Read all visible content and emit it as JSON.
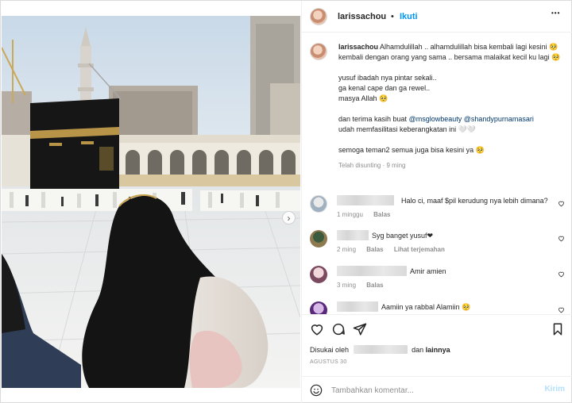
{
  "post": {
    "author": "larissachou",
    "separator": "•",
    "follow_label": "Ikuti",
    "more_label": "•••",
    "carousel": {
      "slide_count": 2,
      "active_slide": 1
    }
  },
  "caption": {
    "username": "larissachou",
    "line1": "Alhamdulillah .. alhamdulillah bisa kembali lagi kesini 🥺",
    "line2": "kembali dengan orang yang sama .. bersama malaikat kecil ku lagi 🥺",
    "line3": "yusuf ibadah nya pintar sekali..",
    "line4": "ga kenal cape dan ga rewel..",
    "line5": "masya Allah 🥺",
    "line6_prefix": "dan terima kasih buat ",
    "mention1": "@msglowbeauty",
    "mention2": "@shandypurnamasari",
    "line7": "udah memfasilitasi keberangkatan ini 🤍🤍",
    "line8": "semoga teman2 semua juga bisa kesini ya 🥺",
    "meta": "Telah disunting · 9 ming"
  },
  "comments": [
    {
      "text": "Halo ci, maaf $pil kerudung nya lebih dimana?",
      "time": "1 minggu",
      "reply": "Balas",
      "translate": ""
    },
    {
      "text": "Syg banget yusuf❤",
      "time": "2 ming",
      "reply": "Balas",
      "translate": "Lihat terjemahan"
    },
    {
      "text": "Amir amien",
      "time": "3 ming",
      "reply": "Balas",
      "translate": ""
    },
    {
      "text": "Aamiin ya rabbal Alamiin 🥺",
      "time": "",
      "reply": "",
      "translate": ""
    }
  ],
  "likes": {
    "prefix": "Disukai oleh",
    "middle": "dan",
    "suffix": "lainnya"
  },
  "date": "AGUSTUS 30",
  "composer": {
    "placeholder": "Tambahkan komentar...",
    "post_label": "Kirim"
  },
  "colors": {
    "link_blue": "#0095f6",
    "mention": "#00376b",
    "muted": "#8e8e8e",
    "post_disabled": "#b2dffc"
  }
}
